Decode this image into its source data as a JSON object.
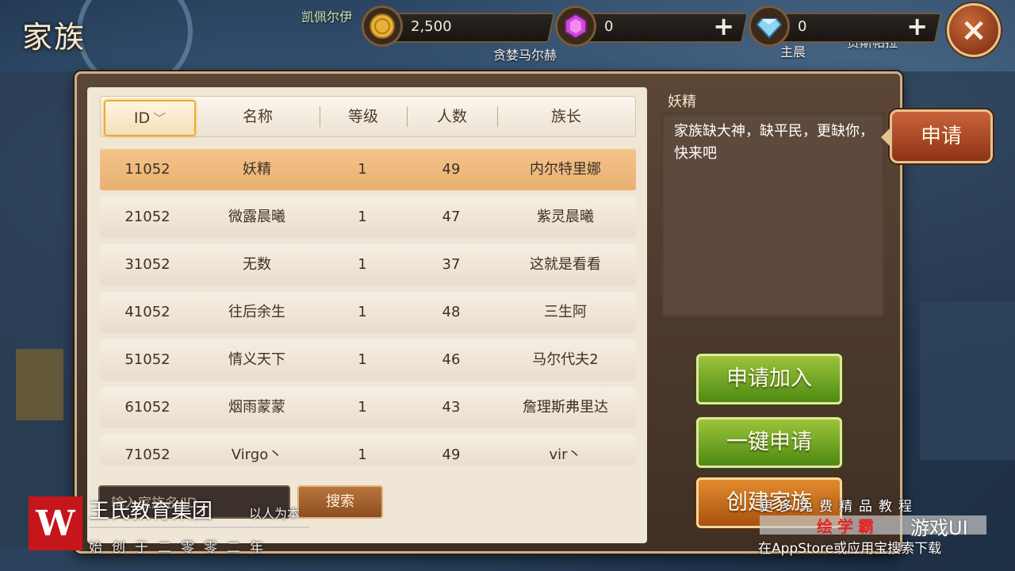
{
  "title": "家族",
  "npc_names": [
    "凯佩尔伊",
    "贪婪马尔赫",
    "主晨",
    "贾斯帕拉"
  ],
  "currency": [
    {
      "icon": "gold-coin-icon",
      "value": "2,500",
      "has_plus": false
    },
    {
      "icon": "purple-gem-icon",
      "value": "0",
      "has_plus": true,
      "plus": "+"
    },
    {
      "icon": "diamond-icon",
      "value": "0",
      "has_plus": true,
      "plus": "+"
    }
  ],
  "close_label": "×",
  "table": {
    "headers": [
      "ID",
      "名称",
      "等级",
      "人数",
      "族长"
    ],
    "sort_indicator": "﹀",
    "rows": [
      {
        "id": "11052",
        "name": "妖精",
        "level": "1",
        "members": "49",
        "leader": "内尔特里娜"
      },
      {
        "id": "21052",
        "name": "微露晨曦",
        "level": "1",
        "members": "47",
        "leader": "紫灵晨曦"
      },
      {
        "id": "31052",
        "name": "无数",
        "level": "1",
        "members": "37",
        "leader": "这就是看看"
      },
      {
        "id": "41052",
        "name": "往后余生",
        "level": "1",
        "members": "48",
        "leader": "三生阿"
      },
      {
        "id": "51052",
        "name": "情义天下",
        "level": "1",
        "members": "46",
        "leader": "马尔代夫2"
      },
      {
        "id": "61052",
        "name": "烟雨蒙蒙",
        "level": "1",
        "members": "43",
        "leader": "詹理斯弗里达"
      },
      {
        "id": "71052",
        "name": "Virgo丶",
        "level": "1",
        "members": "49",
        "leader": "vir丶"
      }
    ],
    "selected_index": 0
  },
  "search": {
    "placeholder": "输入家族名/ID",
    "button": "搜索"
  },
  "detail": {
    "name": "妖精",
    "description": "家族缺大神，缺平民，更缺你，快来吧"
  },
  "apply_tab": "申请",
  "buttons": {
    "join": "申请加入",
    "quick_apply": "一键申请",
    "create": "创建家族"
  },
  "watermark": {
    "logo": "W",
    "org": "王氏教育集团",
    "slogan": "以人为本",
    "since": "始创于二零零二年",
    "right1": "更多免费精品教程",
    "right2a": "绘学霸",
    "right2b": "游戏UI",
    "right3": "在AppStore或应用宝搜索下载"
  }
}
